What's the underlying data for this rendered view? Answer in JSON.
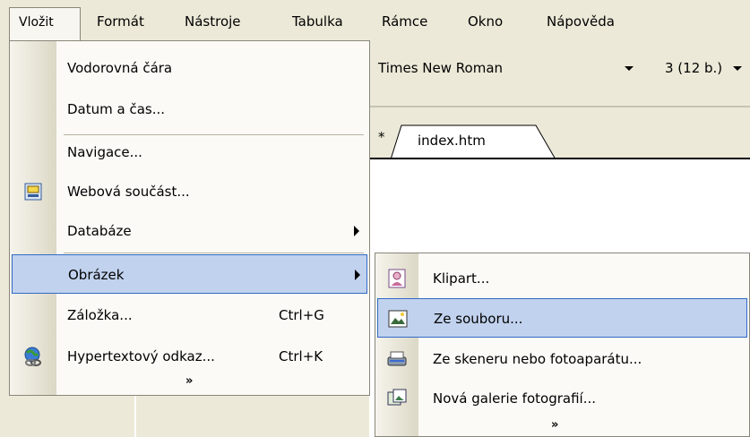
{
  "menubar": {
    "items": [
      {
        "label": "Vložit"
      },
      {
        "label": "Formát"
      },
      {
        "label": "Nástroje"
      },
      {
        "label": "Tabulka"
      },
      {
        "label": "Rámce"
      },
      {
        "label": "Okno"
      },
      {
        "label": "Nápověda"
      }
    ]
  },
  "toolbar": {
    "font_name": "Times New Roman",
    "font_size": "3 (12 b.)"
  },
  "tabs": {
    "active_marker": "*",
    "doc_tab": "index.htm"
  },
  "menu": {
    "items": [
      {
        "label": "Vodorovná čára",
        "icon": ""
      },
      {
        "label": "Datum a čas...",
        "icon": ""
      },
      {
        "label": "Navigace...",
        "icon": ""
      },
      {
        "label": "Webová součást...",
        "icon": "web-component-icon"
      },
      {
        "label": "Databáze",
        "icon": "",
        "submenu": true
      },
      {
        "label": "Obrázek",
        "icon": "",
        "submenu": true,
        "highlighted": true
      },
      {
        "label": "Záložka...",
        "shortcut": "Ctrl+G"
      },
      {
        "label": "Hypertextový odkaz...",
        "shortcut": "Ctrl+K",
        "icon": "hyperlink-globe-icon"
      }
    ],
    "expand_chevron": "»"
  },
  "submenu": {
    "items": [
      {
        "label": "Klipart...",
        "icon": "clipart-icon"
      },
      {
        "label": "Ze souboru...",
        "icon": "picture-file-icon",
        "highlighted": true
      },
      {
        "label": "Ze skeneru nebo fotoaparátu...",
        "icon": "scanner-icon"
      },
      {
        "label": "Nová galerie fotografií...",
        "icon": "photo-gallery-icon"
      }
    ],
    "expand_chevron": "»"
  },
  "colors": {
    "menu_highlight": "#c1d2ee",
    "menu_highlight_border": "#316ac5",
    "chrome": "#ece9d8"
  }
}
